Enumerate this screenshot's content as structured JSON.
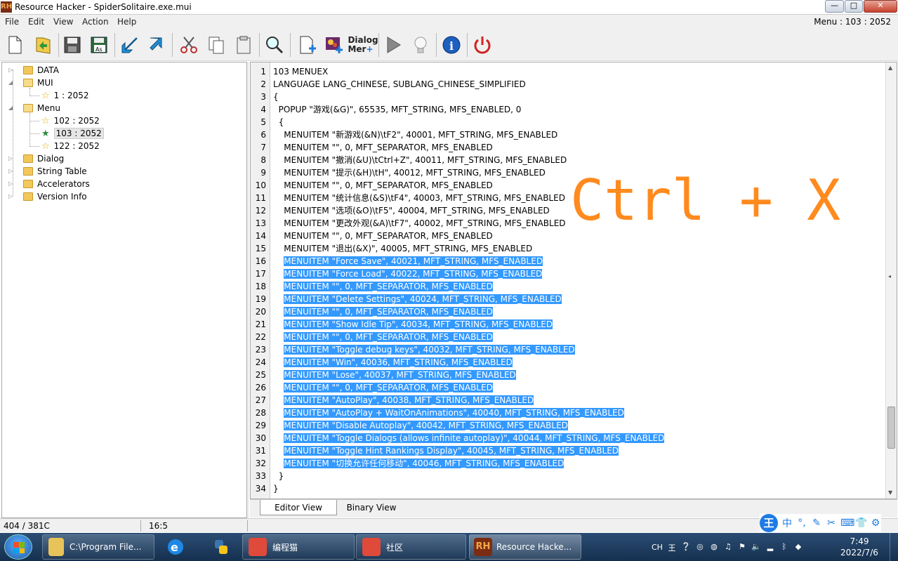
{
  "window": {
    "logo": "RH",
    "title": "Resource Hacker - SpiderSolitaire.exe.mui",
    "min": "—",
    "max": "□",
    "close": "✕"
  },
  "menubar": {
    "items": [
      "File",
      "Edit",
      "View",
      "Action",
      "Help"
    ],
    "status": "Menu : 103 : 2052"
  },
  "toolbar": {
    "dialog_label_1": "Dialog",
    "dialog_label_2": "Mer"
  },
  "tree": {
    "nodes": [
      "DATA",
      "MUI",
      "1 : 2052",
      "Menu",
      "102 : 2052",
      "103 : 2052",
      "122 : 2052",
      "Dialog",
      "String Table",
      "Accelerators",
      "Version Info"
    ]
  },
  "editor": {
    "lines": [
      "103 MENUEX",
      "LANGUAGE LANG_CHINESE, SUBLANG_CHINESE_SIMPLIFIED",
      "{",
      "  POPUP \"游戏(&G)\", 65535, MFT_STRING, MFS_ENABLED, 0",
      "  {",
      "    MENUITEM \"新游戏(&N)\\tF2\", 40001, MFT_STRING, MFS_ENABLED",
      "    MENUITEM \"\", 0, MFT_SEPARATOR, MFS_ENABLED",
      "    MENUITEM \"撤消(&U)\\tCtrl+Z\", 40011, MFT_STRING, MFS_ENABLED",
      "    MENUITEM \"提示(&H)\\tH\", 40012, MFT_STRING, MFS_ENABLED",
      "    MENUITEM \"\", 0, MFT_SEPARATOR, MFS_ENABLED",
      "    MENUITEM \"统计信息(&S)\\tF4\", 40003, MFT_STRING, MFS_ENABLED",
      "    MENUITEM \"选项(&O)\\tF5\", 40004, MFT_STRING, MFS_ENABLED",
      "    MENUITEM \"更改外观(&A)\\tF7\", 40002, MFT_STRING, MFS_ENABLED",
      "    MENUITEM \"\", 0, MFT_SEPARATOR, MFS_ENABLED",
      "    MENUITEM \"退出(&X)\", 40005, MFT_STRING, MFS_ENABLED",
      "    MENUITEM \"Force Save\", 40021, MFT_STRING, MFS_ENABLED",
      "    MENUITEM \"Force Load\", 40022, MFT_STRING, MFS_ENABLED",
      "    MENUITEM \"\", 0, MFT_SEPARATOR, MFS_ENABLED",
      "    MENUITEM \"Delete Settings\", 40024, MFT_STRING, MFS_ENABLED",
      "    MENUITEM \"\", 0, MFT_SEPARATOR, MFS_ENABLED",
      "    MENUITEM \"Show Idle Tip\", 40034, MFT_STRING, MFS_ENABLED",
      "    MENUITEM \"\", 0, MFT_SEPARATOR, MFS_ENABLED",
      "    MENUITEM \"Toggle debug keys\", 40032, MFT_STRING, MFS_ENABLED",
      "    MENUITEM \"Win\", 40036, MFT_STRING, MFS_ENABLED",
      "    MENUITEM \"Lose\", 40037, MFT_STRING, MFS_ENABLED",
      "    MENUITEM \"\", 0, MFT_SEPARATOR, MFS_ENABLED",
      "    MENUITEM \"AutoPlay\", 40038, MFT_STRING, MFS_ENABLED",
      "    MENUITEM \"AutoPlay + WaitOnAnimations\", 40040, MFT_STRING, MFS_ENABLED",
      "    MENUITEM \"Disable Autoplay\", 40042, MFT_STRING, MFS_ENABLED",
      "    MENUITEM \"Toggle Dialogs (allows infinite autoplay)\", 40044, MFT_STRING, MFS_ENABLED",
      "    MENUITEM \"Toggle Hint Rankings Display\", 40045, MFT_STRING, MFS_ENABLED",
      "    MENUITEM \"切换允许任何移动\", 40046, MFT_STRING, MFS_ENABLED",
      "  }",
      "}"
    ],
    "selection_color": "#3399ff",
    "overlay": "Ctrl + X",
    "overlay_color": "#ff8a1e"
  },
  "tabs": [
    "Editor View",
    "Binary View"
  ],
  "statusbar": {
    "position": "404 / 381C",
    "cursor": "16:5"
  },
  "ime": {
    "logo": "王",
    "items": [
      "中",
      "°,",
      "✎",
      "✂",
      "⌨",
      "👕",
      "⚙"
    ]
  },
  "taskbar": {
    "buttons": [
      "C:\\Program File...",
      "编程猫",
      "社区",
      "Resource Hacke..."
    ],
    "tray_lang": "CH",
    "time": "7:49",
    "date": "2022/7/6"
  }
}
